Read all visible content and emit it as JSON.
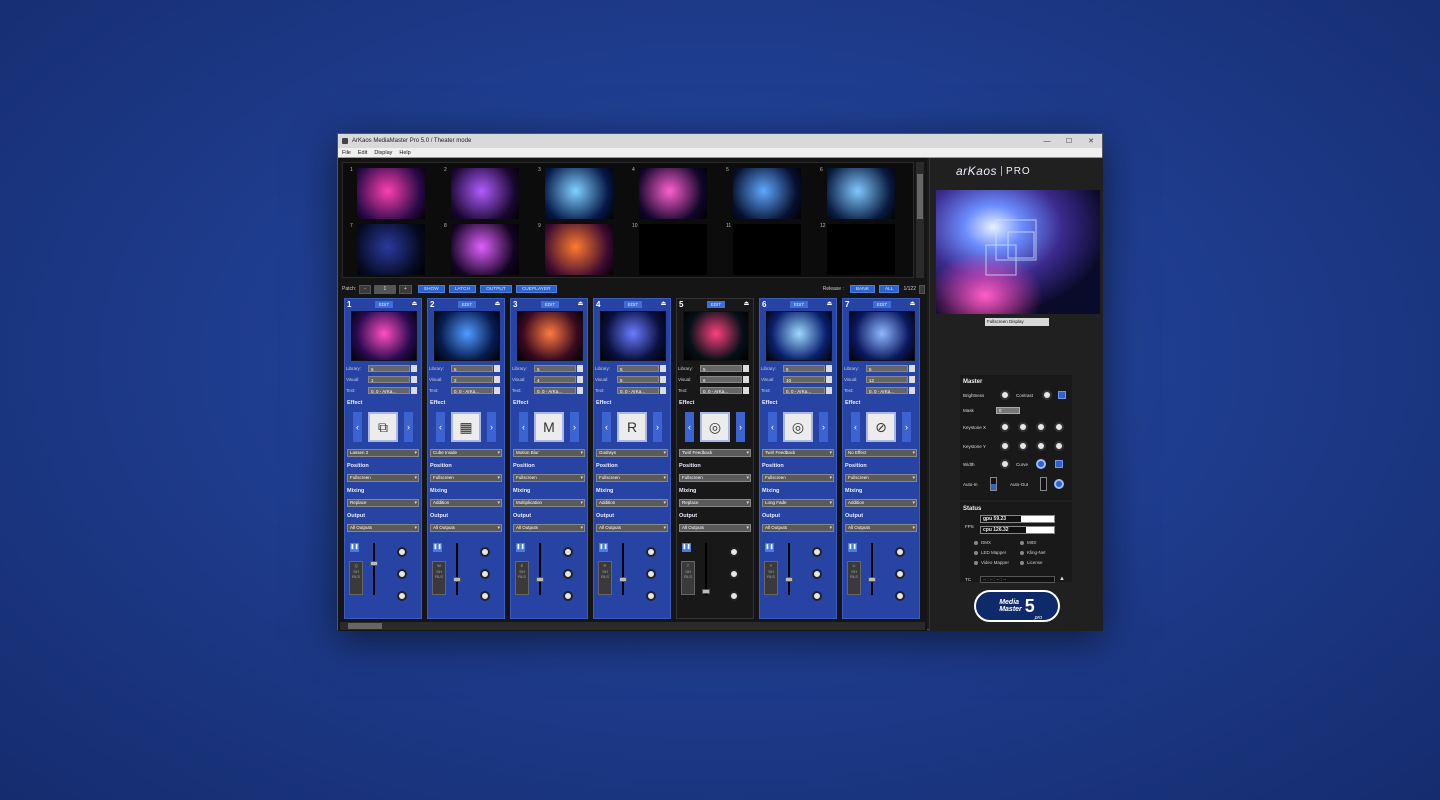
{
  "window": {
    "title": "ArKaos MediaMaster Pro 5.0 / Theater mode",
    "controls": [
      "—",
      "☐",
      "✕"
    ]
  },
  "menu": [
    "File",
    "Edit",
    "Display",
    "Help"
  ],
  "library_thumbs": [
    "1",
    "2",
    "3",
    "4",
    "5",
    "6",
    "7",
    "8",
    "9",
    "10",
    "11",
    "12"
  ],
  "patch": {
    "label": "Patch:",
    "minus": "-",
    "value": "1",
    "plus": "+",
    "modes": [
      "SHOW",
      "LATCH",
      "OUTPUT",
      "CUEPLAYER"
    ],
    "release_label": "Release :",
    "release_buttons": [
      "BANK",
      "ALL"
    ],
    "page": "1/122"
  },
  "labels": {
    "library": "Library:",
    "visual": "Visual:",
    "text": "Text:",
    "effect": "Effect",
    "position": "Position",
    "mixing": "Mixing",
    "output": "Output",
    "edit": "EDIT"
  },
  "layers": [
    {
      "num": "1",
      "library": "5",
      "visual": "1",
      "text": "0. 0 - ArKa...",
      "effect": "Lassen 2",
      "position": "Fullscreen",
      "mixing": "Replace",
      "output": "All Outputs",
      "key": "Q"
    },
    {
      "num": "2",
      "library": "5",
      "visual": "2",
      "text": "0. 0 - ArKa...",
      "effect": "Cube Inside",
      "position": "Fullscreen",
      "mixing": "Addition",
      "output": "All Outputs",
      "key": "W"
    },
    {
      "num": "3",
      "library": "5",
      "visual": "4",
      "text": "0. 0 - ArKa...",
      "effect": "Motion Blur",
      "position": "Fullscreen",
      "mixing": "Multiplication",
      "output": "All Outputs",
      "key": "E"
    },
    {
      "num": "4",
      "library": "5",
      "visual": "5",
      "text": "0. 0 - ArKa...",
      "effect": "Godrays",
      "position": "Fullscreen",
      "mixing": "Addition",
      "output": "All Outputs",
      "key": "R"
    },
    {
      "num": "5",
      "library": "5",
      "visual": "6",
      "text": "0. 0 - ArKa...",
      "effect": "Twirl Feedback",
      "position": "Fullscreen",
      "mixing": "Replace",
      "output": "All Outputs",
      "key": "T"
    },
    {
      "num": "6",
      "library": "5",
      "visual": "10",
      "text": "0. 0 - ArKa...",
      "effect": "Twirl Feedback",
      "position": "Fullscreen",
      "mixing": "Long Fade",
      "output": "All Outputs",
      "key": "Y"
    },
    {
      "num": "7",
      "library": "5",
      "visual": "12",
      "text": "0. 0 - ArKa...",
      "effect": "No Effect",
      "position": "Fullscreen",
      "mixing": "Addition",
      "output": "All Outputs",
      "key": "U"
    }
  ],
  "right": {
    "logo_left": "arKaos",
    "logo_right": "PRO",
    "display_select": "Fullscreen Display",
    "master": {
      "title": "Master",
      "brightness": "Brightness",
      "contrast": "Contrast",
      "mask": "Mask",
      "mask_value": "0",
      "keystone_x": "Keystone X",
      "keystone_y": "Keystone Y",
      "width": "Width",
      "curve": "Curve",
      "auto_in": "Auto-In",
      "auto_out": "Auto-Out"
    },
    "status": {
      "title": "Status",
      "fps_label": "FPS",
      "gpu": "gpu 59.23",
      "cpu": "cpu 126.32",
      "gpu_fill": 0.55,
      "cpu_fill": 0.62,
      "indicators": [
        "DMX",
        "MIDI",
        "LED Mapper",
        "Kling-Net",
        "Video Mapper",
        "License"
      ],
      "tc_label": "TC",
      "tc_value": "-- : -- : -- : --"
    },
    "badge": {
      "line1": "Media",
      "line2": "Master",
      "number": "5",
      "sub": "pro"
    }
  },
  "colors": {
    "strip": "#2744a4",
    "accent": "#2f63c8",
    "bg": "#1f3d8f"
  }
}
